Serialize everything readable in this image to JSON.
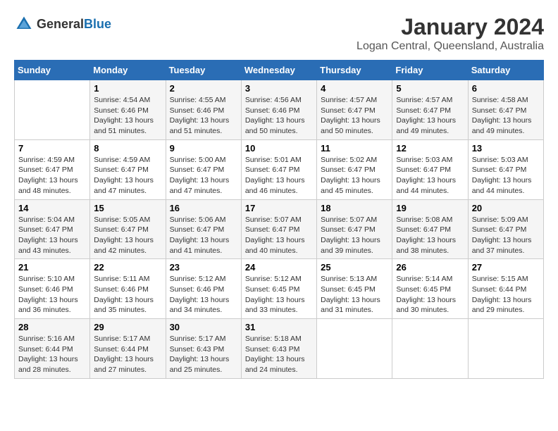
{
  "header": {
    "logo_general": "General",
    "logo_blue": "Blue",
    "month": "January 2024",
    "location": "Logan Central, Queensland, Australia"
  },
  "calendar": {
    "days_of_week": [
      "Sunday",
      "Monday",
      "Tuesday",
      "Wednesday",
      "Thursday",
      "Friday",
      "Saturday"
    ],
    "weeks": [
      [
        {
          "day": "",
          "text": ""
        },
        {
          "day": "1",
          "text": "Sunrise: 4:54 AM\nSunset: 6:46 PM\nDaylight: 13 hours\nand 51 minutes."
        },
        {
          "day": "2",
          "text": "Sunrise: 4:55 AM\nSunset: 6:46 PM\nDaylight: 13 hours\nand 51 minutes."
        },
        {
          "day": "3",
          "text": "Sunrise: 4:56 AM\nSunset: 6:46 PM\nDaylight: 13 hours\nand 50 minutes."
        },
        {
          "day": "4",
          "text": "Sunrise: 4:57 AM\nSunset: 6:47 PM\nDaylight: 13 hours\nand 50 minutes."
        },
        {
          "day": "5",
          "text": "Sunrise: 4:57 AM\nSunset: 6:47 PM\nDaylight: 13 hours\nand 49 minutes."
        },
        {
          "day": "6",
          "text": "Sunrise: 4:58 AM\nSunset: 6:47 PM\nDaylight: 13 hours\nand 49 minutes."
        }
      ],
      [
        {
          "day": "7",
          "text": "Sunrise: 4:59 AM\nSunset: 6:47 PM\nDaylight: 13 hours\nand 48 minutes."
        },
        {
          "day": "8",
          "text": "Sunrise: 4:59 AM\nSunset: 6:47 PM\nDaylight: 13 hours\nand 47 minutes."
        },
        {
          "day": "9",
          "text": "Sunrise: 5:00 AM\nSunset: 6:47 PM\nDaylight: 13 hours\nand 47 minutes."
        },
        {
          "day": "10",
          "text": "Sunrise: 5:01 AM\nSunset: 6:47 PM\nDaylight: 13 hours\nand 46 minutes."
        },
        {
          "day": "11",
          "text": "Sunrise: 5:02 AM\nSunset: 6:47 PM\nDaylight: 13 hours\nand 45 minutes."
        },
        {
          "day": "12",
          "text": "Sunrise: 5:03 AM\nSunset: 6:47 PM\nDaylight: 13 hours\nand 44 minutes."
        },
        {
          "day": "13",
          "text": "Sunrise: 5:03 AM\nSunset: 6:47 PM\nDaylight: 13 hours\nand 44 minutes."
        }
      ],
      [
        {
          "day": "14",
          "text": "Sunrise: 5:04 AM\nSunset: 6:47 PM\nDaylight: 13 hours\nand 43 minutes."
        },
        {
          "day": "15",
          "text": "Sunrise: 5:05 AM\nSunset: 6:47 PM\nDaylight: 13 hours\nand 42 minutes."
        },
        {
          "day": "16",
          "text": "Sunrise: 5:06 AM\nSunset: 6:47 PM\nDaylight: 13 hours\nand 41 minutes."
        },
        {
          "day": "17",
          "text": "Sunrise: 5:07 AM\nSunset: 6:47 PM\nDaylight: 13 hours\nand 40 minutes."
        },
        {
          "day": "18",
          "text": "Sunrise: 5:07 AM\nSunset: 6:47 PM\nDaylight: 13 hours\nand 39 minutes."
        },
        {
          "day": "19",
          "text": "Sunrise: 5:08 AM\nSunset: 6:47 PM\nDaylight: 13 hours\nand 38 minutes."
        },
        {
          "day": "20",
          "text": "Sunrise: 5:09 AM\nSunset: 6:47 PM\nDaylight: 13 hours\nand 37 minutes."
        }
      ],
      [
        {
          "day": "21",
          "text": "Sunrise: 5:10 AM\nSunset: 6:46 PM\nDaylight: 13 hours\nand 36 minutes."
        },
        {
          "day": "22",
          "text": "Sunrise: 5:11 AM\nSunset: 6:46 PM\nDaylight: 13 hours\nand 35 minutes."
        },
        {
          "day": "23",
          "text": "Sunrise: 5:12 AM\nSunset: 6:46 PM\nDaylight: 13 hours\nand 34 minutes."
        },
        {
          "day": "24",
          "text": "Sunrise: 5:12 AM\nSunset: 6:45 PM\nDaylight: 13 hours\nand 33 minutes."
        },
        {
          "day": "25",
          "text": "Sunrise: 5:13 AM\nSunset: 6:45 PM\nDaylight: 13 hours\nand 31 minutes."
        },
        {
          "day": "26",
          "text": "Sunrise: 5:14 AM\nSunset: 6:45 PM\nDaylight: 13 hours\nand 30 minutes."
        },
        {
          "day": "27",
          "text": "Sunrise: 5:15 AM\nSunset: 6:44 PM\nDaylight: 13 hours\nand 29 minutes."
        }
      ],
      [
        {
          "day": "28",
          "text": "Sunrise: 5:16 AM\nSunset: 6:44 PM\nDaylight: 13 hours\nand 28 minutes."
        },
        {
          "day": "29",
          "text": "Sunrise: 5:17 AM\nSunset: 6:44 PM\nDaylight: 13 hours\nand 27 minutes."
        },
        {
          "day": "30",
          "text": "Sunrise: 5:17 AM\nSunset: 6:43 PM\nDaylight: 13 hours\nand 25 minutes."
        },
        {
          "day": "31",
          "text": "Sunrise: 5:18 AM\nSunset: 6:43 PM\nDaylight: 13 hours\nand 24 minutes."
        },
        {
          "day": "",
          "text": ""
        },
        {
          "day": "",
          "text": ""
        },
        {
          "day": "",
          "text": ""
        }
      ]
    ]
  }
}
